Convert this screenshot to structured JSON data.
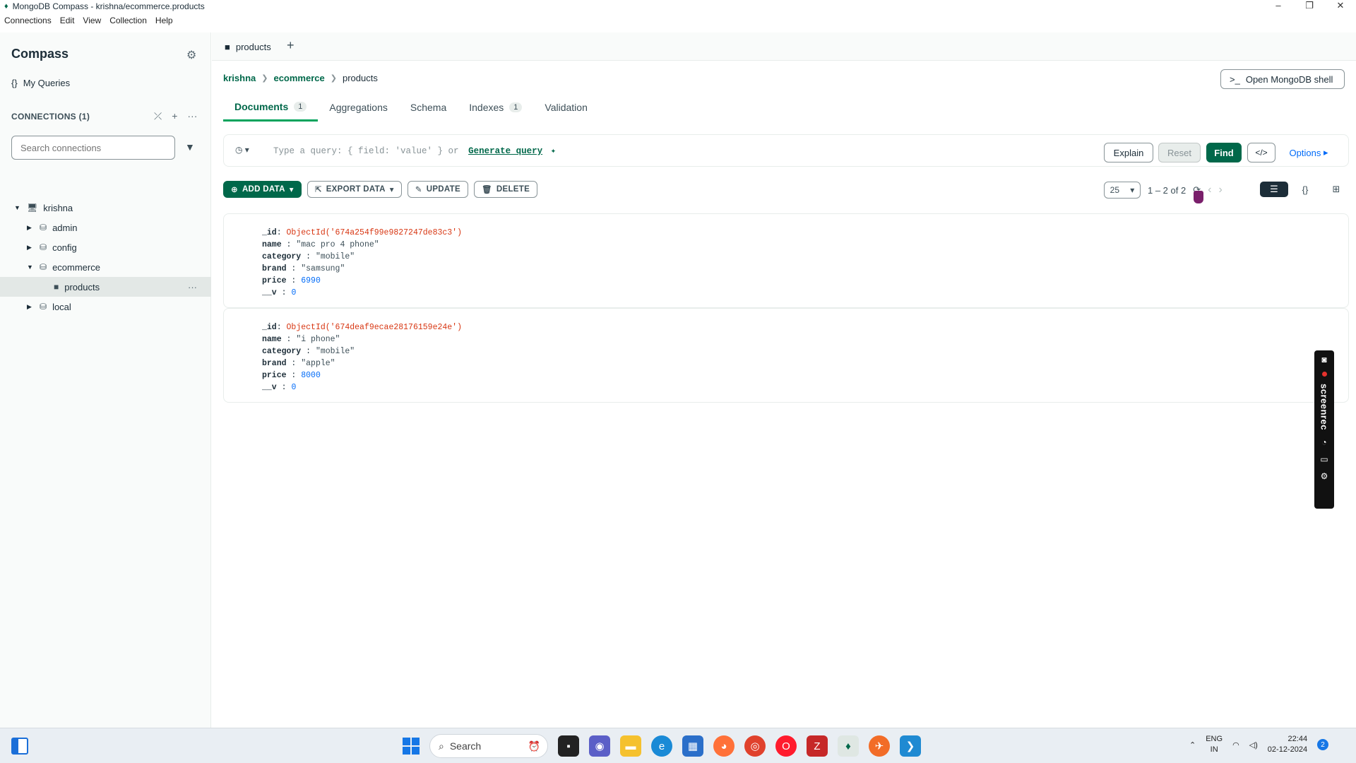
{
  "window": {
    "title": "MongoDB Compass - krishna/ecommerce.products"
  },
  "menu": [
    "Connections",
    "Edit",
    "View",
    "Collection",
    "Help"
  ],
  "sidebar": {
    "app_title": "Compass",
    "my_queries": "My Queries",
    "connections_header": "CONNECTIONS (1)",
    "search_placeholder": "Search connections",
    "tree": [
      {
        "label": "krishna",
        "level": "connection",
        "caret": "▼"
      },
      {
        "label": "admin",
        "level": "database",
        "caret": "▶"
      },
      {
        "label": "config",
        "level": "database",
        "caret": "▶"
      },
      {
        "label": "ecommerce",
        "level": "database",
        "caret": "▼"
      },
      {
        "label": "products",
        "level": "collection",
        "caret": ""
      },
      {
        "label": "local",
        "level": "database",
        "caret": "▶"
      }
    ]
  },
  "tabbar": {
    "tab_label": "products"
  },
  "breadcrumb": [
    "krishna",
    "ecommerce",
    "products"
  ],
  "shell_button": "Open MongoDB shell",
  "subtabs": [
    {
      "label": "Documents",
      "count": "1"
    },
    {
      "label": "Aggregations",
      "count": ""
    },
    {
      "label": "Schema",
      "count": ""
    },
    {
      "label": "Indexes",
      "count": "1"
    },
    {
      "label": "Validation",
      "count": ""
    }
  ],
  "querybar": {
    "placeholder": "Type a query: { field: 'value' } or",
    "generate": "Generate query",
    "explain": "Explain",
    "reset": "Reset",
    "find": "Find",
    "options": "Options"
  },
  "toolbar": {
    "add_data": "ADD DATA",
    "export_data": "EXPORT DATA",
    "update": "UPDATE",
    "delete": "DELETE"
  },
  "pager": {
    "page_size": "25",
    "range": "1 – 2 of 2"
  },
  "documents": [
    {
      "_id": "ObjectId('674a254f99e9827247de83c3')",
      "name": "\"mac pro 4 phone\"",
      "category": "\"mobile\"",
      "brand": "\"samsung\"",
      "price": "6990",
      "__v": "0"
    },
    {
      "_id": "ObjectId('674deaf9ecae28176159e24e')",
      "name": "\"i phone\"",
      "category": "\"mobile\"",
      "brand": "\"apple\"",
      "price": "8000",
      "__v": "0"
    }
  ],
  "recorder_widget": {
    "label": "screenrec"
  },
  "taskbar": {
    "search_label": "Search",
    "language": "ENG",
    "region": "IN",
    "time": "22:44",
    "date": "02-12-2024"
  },
  "colors": {
    "accent": "#00684a",
    "link": "#016bf8",
    "objectid": "#d83713"
  }
}
